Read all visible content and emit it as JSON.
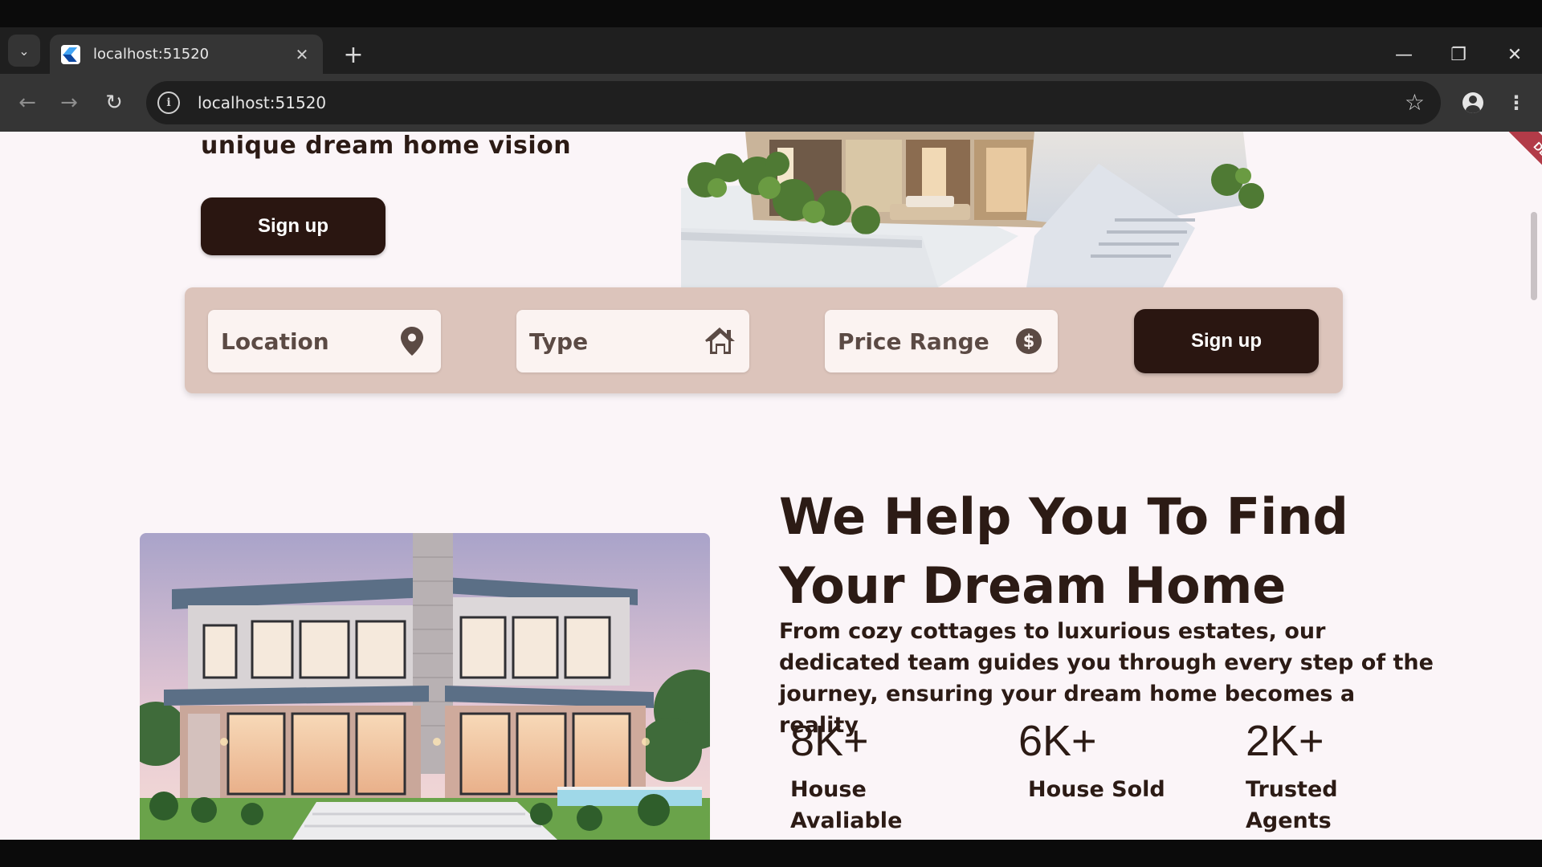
{
  "browser": {
    "tab_title": "localhost:51520",
    "url": "localhost:51520"
  },
  "hero": {
    "tagline_fragment": "unique dream home vision",
    "signup_label": "Sign up"
  },
  "search": {
    "location_label": "Location",
    "type_label": "Type",
    "price_label": "Price Range",
    "signup_label": "Sign up"
  },
  "debug_banner": "DEBUG",
  "about": {
    "headline_line1": "We Help You To Find",
    "headline_line2": "Your Dream Home",
    "paragraph": "From cozy cottages to luxurious estates, our dedicated team guides you through every step of the journey, ensuring your dream home becomes a reality"
  },
  "stats": [
    {
      "value": "8K+",
      "label": "House Avaliable"
    },
    {
      "value": "6K+",
      "label": "House Sold"
    },
    {
      "value": "2K+",
      "label": "Trusted Agents"
    }
  ],
  "colors": {
    "primary_dark": "#2a1611",
    "panel": "#dcc4bb",
    "background": "#fbf5f8",
    "text": "#2c1b15"
  }
}
